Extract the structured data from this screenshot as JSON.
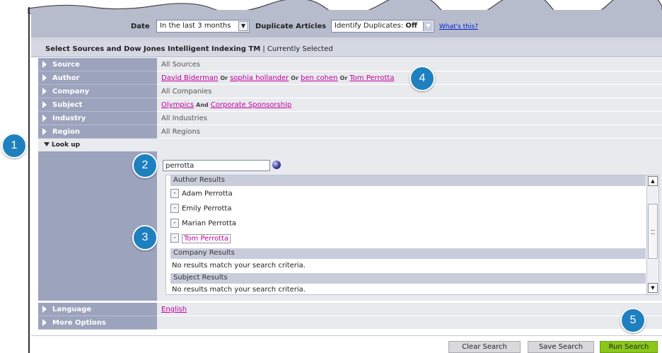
{
  "filters": {
    "date_label": "Date",
    "date_value": "In the last 3 months",
    "duplicate_label": "Duplicate Articles",
    "duplicate_prefix": "Identify Duplicates: ",
    "duplicate_value": "Off",
    "whats_this": "What's this?"
  },
  "section": {
    "title": "Select Sources and Dow Jones Intelligent Indexing TM",
    "separator": "|",
    "subtitle": "Currently Selected"
  },
  "rows": {
    "source": {
      "label": "Source",
      "value": "All Sources"
    },
    "author": {
      "label": "Author",
      "links": [
        "David Biderman",
        "sophia hollander",
        "ben cohen",
        "Tom Perrotta"
      ],
      "op": "Or"
    },
    "company": {
      "label": "Company",
      "value": "All Companies"
    },
    "subject": {
      "label": "Subject",
      "links": [
        "Olympics",
        "Corporate Sponsorship"
      ],
      "op": "And"
    },
    "industry": {
      "label": "Industry",
      "value": "All Industries"
    },
    "region": {
      "label": "Region",
      "value": "All Regions"
    },
    "language": {
      "label": "Language",
      "link": "English"
    },
    "more": {
      "label": "More Options"
    }
  },
  "lookup": {
    "label": "Look up",
    "query": "perrotta",
    "author_heading": "Author Results",
    "authors": [
      "Adam Perrotta",
      "Emily Perrotta",
      "Marian Perrotta",
      "Tom Perrotta"
    ],
    "add_symbol": "-",
    "company_heading": "Company Results",
    "company_empty": "No results match your search criteria.",
    "subject_heading": "Subject Results",
    "subject_empty": "No results match your search criteria."
  },
  "buttons": {
    "clear": "Clear Search",
    "save": "Save Search",
    "run": "Run Search"
  },
  "callouts": [
    "1",
    "2",
    "3",
    "4",
    "5"
  ],
  "colors": {
    "label_bg": "#9ca3bd",
    "link": "#c000a0",
    "callout": "#1f80c0",
    "run_button": "#8ac71c"
  }
}
